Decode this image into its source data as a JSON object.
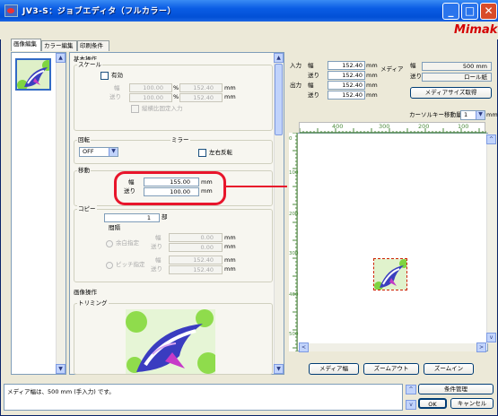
{
  "window": {
    "title": "JV3-S：ジョブエディタ（フルカラー）",
    "logo": "Mimaki"
  },
  "tabs": [
    {
      "label": "画像編集",
      "selected": true
    },
    {
      "label": "カラー編集",
      "selected": false
    },
    {
      "label": "印刷条件",
      "selected": false
    }
  ],
  "basic": {
    "title": "基本操作",
    "scale": {
      "title": "スケール",
      "enabled_label": "有効",
      "width_label": "幅",
      "feed_label": "送り",
      "width_pct": "100.00",
      "feed_pct": "100.00",
      "pct_unit": "%",
      "width_mm": "152.40",
      "feed_mm": "152.40",
      "mm_unit": "mm",
      "keep_ratio_label": "縦横比固定入力"
    },
    "rotate": {
      "title": "回転",
      "value": "OFF"
    },
    "mirror": {
      "title": "ミラー",
      "lr_label": "左右反転"
    },
    "move": {
      "title": "移動",
      "width_label": "幅",
      "feed_label": "送り",
      "width": "155.00",
      "feed": "100.00",
      "unit": "mm"
    },
    "copy": {
      "title": "コピー",
      "count": "1",
      "count_unit": "部",
      "interval_title": "間隔",
      "margin_label": "余白指定",
      "pitch_label": "ピッチ指定",
      "width_label": "幅",
      "feed_label": "送り",
      "margin_width": "0.00",
      "margin_feed": "0.00",
      "pitch_width": "152.40",
      "pitch_feed": "152.40",
      "unit": "mm"
    }
  },
  "image_ops": {
    "title": "画像操作",
    "trim_title": "トリミング"
  },
  "right": {
    "input_label": "入力",
    "output_label": "出力",
    "width_label": "幅",
    "feed_label": "送り",
    "input_width": "152.40",
    "input_feed": "152.40",
    "output_width": "152.40",
    "output_feed": "152.40",
    "unit": "mm",
    "media_label": "メディア",
    "media_width_label": "幅",
    "media_feed_label": "送り",
    "media_width": "500 mm",
    "media_feed": "ロール紙",
    "get_media_size": "メディアサイズ取得",
    "cursor_key_label": "カーソルキー移動量",
    "cursor_key_value": "1",
    "cursor_unit": "mm",
    "ruler_h_ticks": [
      "400",
      "300",
      "200",
      "100"
    ],
    "ruler_v_ticks": [
      "0",
      "100",
      "200",
      "300",
      "400",
      "500"
    ],
    "media_width_btn": "メディア幅",
    "zoom_out_btn": "ズームアウト",
    "zoom_in_btn": "ズームイン"
  },
  "status": {
    "message": "メディア幅は、500 mm (手入力) です。"
  },
  "buttons": {
    "condition_mgmt": "条件管理",
    "ok": "OK",
    "cancel": "キャンセル"
  },
  "callout": {
    "label": "入力"
  },
  "colors": {
    "title_bar": "#0a5ce4",
    "highlight": "#e8152b",
    "logo": "#d40000"
  }
}
